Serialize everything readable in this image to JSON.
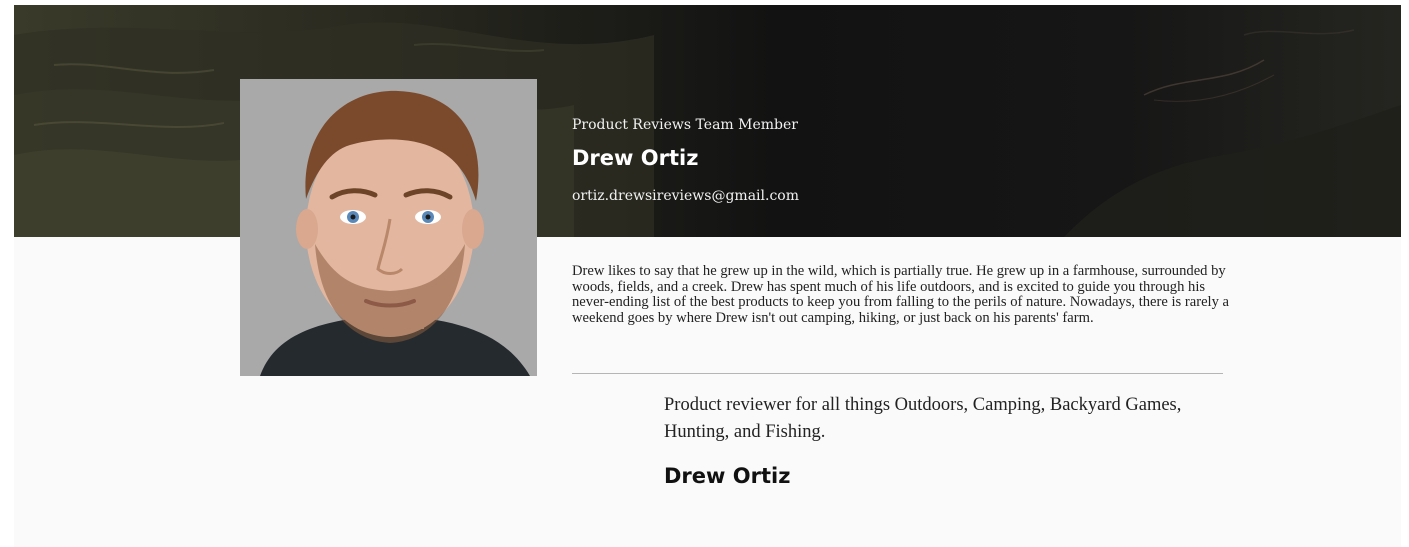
{
  "profile": {
    "role": "Product Reviews Team Member",
    "name": "Drew Ortiz",
    "email": "ortiz.drewsireviews@gmail.com",
    "bio": "Drew likes to say that he grew up in the wild, which is partially true. He grew up in a farmhouse, surrounded by woods, fields, and a creek. Drew has spent much of his life outdoors, and is excited to guide you through his never-ending list of the best products to keep you from falling to the perils of nature. Nowadays, there is rarely a weekend goes by where Drew isn't out camping, hiking, or just back on his parents' farm.",
    "tagline": "Product reviewer for all things Outdoors, Camping, Backyard Games, Hunting, and Fishing.",
    "signature_name": "Drew Ortiz"
  },
  "colors": {
    "hero_background": "#121212",
    "photo_background": "#a9a9a9",
    "page_background": "#fafafa",
    "body_text": "#222222",
    "divider": "#b5b5b5"
  },
  "icons": {
    "hero_image": "mountain-landscape-image",
    "profile_photo": "person-portrait-image"
  }
}
